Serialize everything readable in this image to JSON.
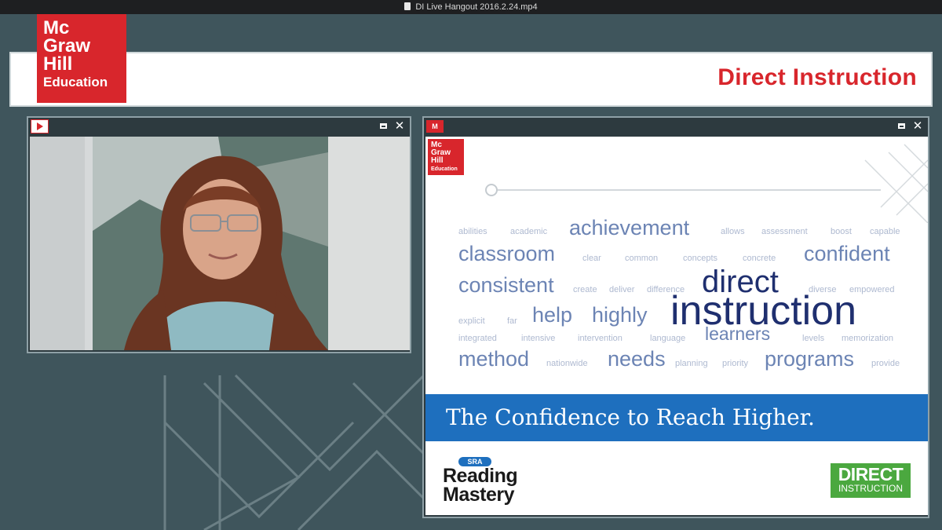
{
  "window": {
    "title": "DI Live Hangout 2016.2.24.mp4"
  },
  "brand": {
    "logo_lines": [
      "Mc",
      "Graw",
      "Hill",
      "Education"
    ],
    "header_title": "Direct Instruction",
    "red": "#d8262c"
  },
  "video_panel": {
    "icon": "play-icon"
  },
  "slide_panel": {
    "icon": "mgh-small-logo",
    "badge_text": "M",
    "logo_lines": [
      "Mc",
      "Graw",
      "Hill",
      "Education"
    ],
    "word_cloud": [
      "abilities",
      "academic",
      "achievement",
      "allows",
      "assessment",
      "boost",
      "capable",
      "classroom",
      "clear",
      "common",
      "concepts",
      "concrete",
      "confident",
      "consistent",
      "create",
      "deliver",
      "difference",
      "direct",
      "diverse",
      "empowered",
      "instruction",
      "explicit",
      "far",
      "help",
      "highly",
      "learners",
      "integrated",
      "intensive",
      "intervention",
      "language",
      "levels",
      "memorization",
      "method",
      "nationwide",
      "needs",
      "planning",
      "priority",
      "programs",
      "provide"
    ],
    "tagline": "The Confidence to Reach Higher.",
    "reading_mastery": {
      "badge": "SRA",
      "line1": "Reading",
      "line2": "Mastery"
    },
    "di_logo": {
      "line1": "DIRECT",
      "line2": "INSTRUCTION"
    },
    "accent_blue": "#1e6fbe",
    "accent_green": "#4ba83f"
  },
  "controls": {
    "maximize_icon": "maximize-icon",
    "close_label": "✕"
  }
}
